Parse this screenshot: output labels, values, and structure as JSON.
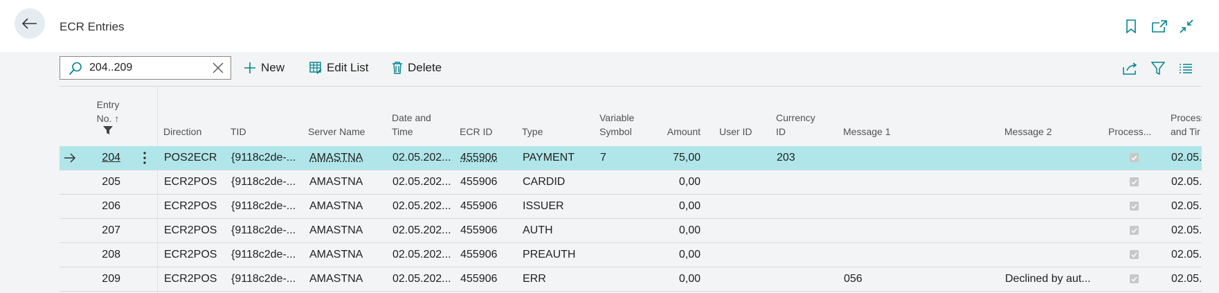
{
  "page": {
    "title": "ECR Entries"
  },
  "search": {
    "value": "204..209"
  },
  "toolbar": {
    "new_label": "New",
    "edit_list_label": "Edit List",
    "delete_label": "Delete"
  },
  "icons": {
    "back": "back-arrow-icon",
    "bookmark": "bookmark-icon",
    "open_new": "open-in-new-window-icon",
    "collapse": "collapse-icon",
    "share": "share-icon",
    "filter": "filter-icon",
    "list": "list-view-icon"
  },
  "colors": {
    "selected_row": "#b0e6ea",
    "accent": "#00838f"
  },
  "columns": {
    "entry_no_l1": "Entry",
    "entry_no_l2": "No. ↑",
    "direction": "Direction",
    "tid": "TID",
    "server_name": "Server Name",
    "date_l1": "Date and",
    "date_l2": "Time",
    "ecr_id": "ECR ID",
    "type": "Type",
    "varsym_l1": "Variable",
    "varsym_l2": "Symbol",
    "amount": "Amount",
    "user_id": "User ID",
    "currency_l1": "Currency",
    "currency_l2": "ID",
    "message1": "Message 1",
    "message2": "Message 2",
    "processed": "Process...",
    "processed_at_l1": "Process",
    "processed_at_l2": "and Tir"
  },
  "rows": [
    {
      "entry": "204",
      "direction": "POS2ECR",
      "tid": "{9118c2de-...",
      "server": "AMASTNA",
      "date": "02.05.202...",
      "ecr": "455906",
      "type": "PAYMENT",
      "varsym": "7",
      "amount": "75,00",
      "user": "",
      "currency": "203",
      "msg1": "",
      "msg2": "",
      "processed": true,
      "proc_at": "02.05."
    },
    {
      "entry": "205",
      "direction": "ECR2POS",
      "tid": "{9118c2de-...",
      "server": "AMASTNA",
      "date": "02.05.202...",
      "ecr": "455906",
      "type": "CARDID",
      "varsym": "",
      "amount": "0,00",
      "user": "",
      "currency": "",
      "msg1": "",
      "msg2": "",
      "processed": true,
      "proc_at": "02.05."
    },
    {
      "entry": "206",
      "direction": "ECR2POS",
      "tid": "{9118c2de-...",
      "server": "AMASTNA",
      "date": "02.05.202...",
      "ecr": "455906",
      "type": "ISSUER",
      "varsym": "",
      "amount": "0,00",
      "user": "",
      "currency": "",
      "msg1": "",
      "msg2": "",
      "processed": true,
      "proc_at": "02.05."
    },
    {
      "entry": "207",
      "direction": "ECR2POS",
      "tid": "{9118c2de-...",
      "server": "AMASTNA",
      "date": "02.05.202...",
      "ecr": "455906",
      "type": "AUTH",
      "varsym": "",
      "amount": "0,00",
      "user": "",
      "currency": "",
      "msg1": "",
      "msg2": "",
      "processed": true,
      "proc_at": "02.05."
    },
    {
      "entry": "208",
      "direction": "ECR2POS",
      "tid": "{9118c2de-...",
      "server": "AMASTNA",
      "date": "02.05.202...",
      "ecr": "455906",
      "type": "PREAUTH",
      "varsym": "",
      "amount": "0,00",
      "user": "",
      "currency": "",
      "msg1": "",
      "msg2": "",
      "processed": true,
      "proc_at": "02.05."
    },
    {
      "entry": "209",
      "direction": "ECR2POS",
      "tid": "{9118c2de-...",
      "server": "AMASTNA",
      "date": "02.05.202...",
      "ecr": "455906",
      "type": "ERR",
      "varsym": "",
      "amount": "0,00",
      "user": "",
      "currency": "",
      "msg1": "056",
      "msg2": "Declined by aut...",
      "processed": true,
      "proc_at": "02.05."
    }
  ]
}
